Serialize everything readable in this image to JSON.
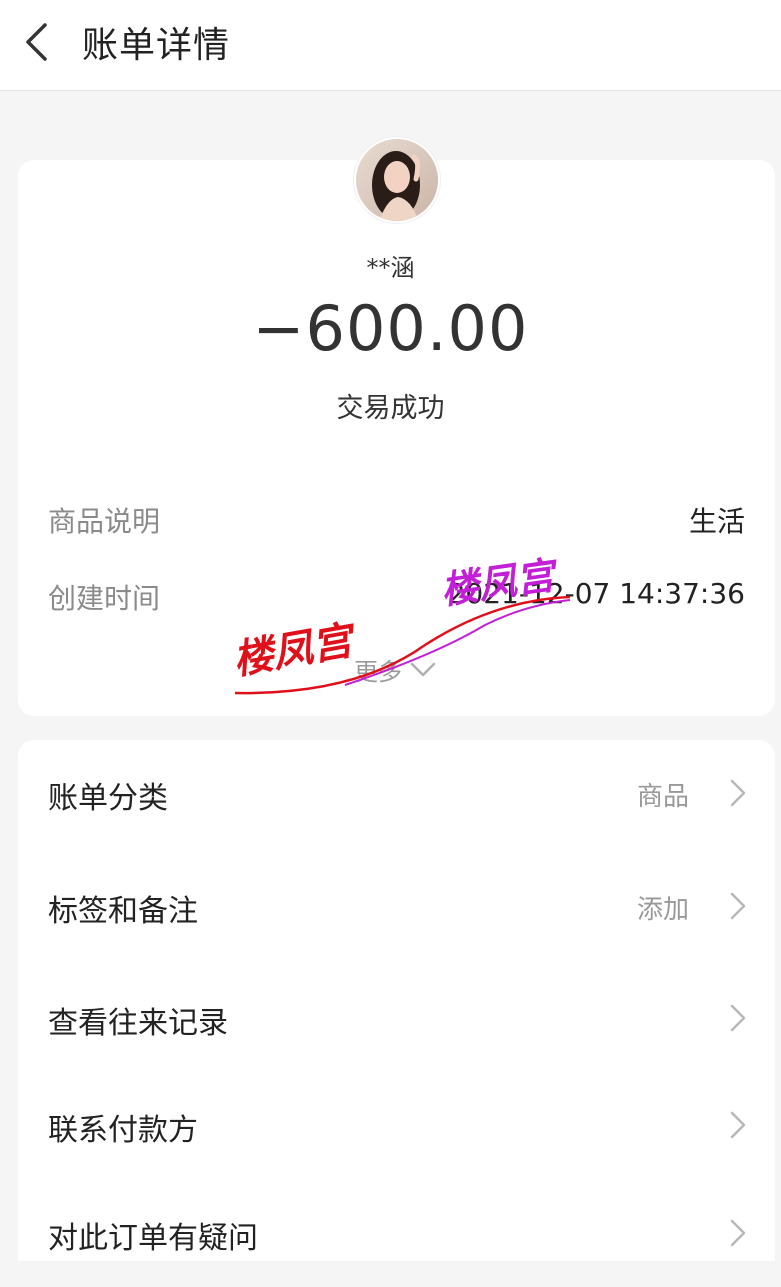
{
  "header": {
    "title": "账单详情",
    "back_icon": "chevron-left-icon"
  },
  "summary": {
    "payee_name": "**涵",
    "amount": "−600.00",
    "status": "交易成功"
  },
  "details": [
    {
      "label": "商品说明",
      "value": "生活"
    },
    {
      "label": "创建时间",
      "value": "2021-12-07 14:37:36"
    }
  ],
  "more": {
    "label": "更多",
    "icon": "chevron-down-icon"
  },
  "actions": [
    {
      "label": "账单分类",
      "value": "商品"
    },
    {
      "label": "标签和备注",
      "value": "添加"
    },
    {
      "label": "查看往来记录",
      "value": ""
    },
    {
      "label": "联系付款方",
      "value": ""
    },
    {
      "label": "对此订单有疑问",
      "value": ""
    }
  ],
  "watermark": {
    "text_left": "楼凤宫",
    "text_right": "楼凤宫",
    "color_left": "#e0101a",
    "color_right": "#c21fd6"
  },
  "colors": {
    "background": "#f5f5f5",
    "card": "#ffffff",
    "muted_text": "#8a8a8a"
  }
}
